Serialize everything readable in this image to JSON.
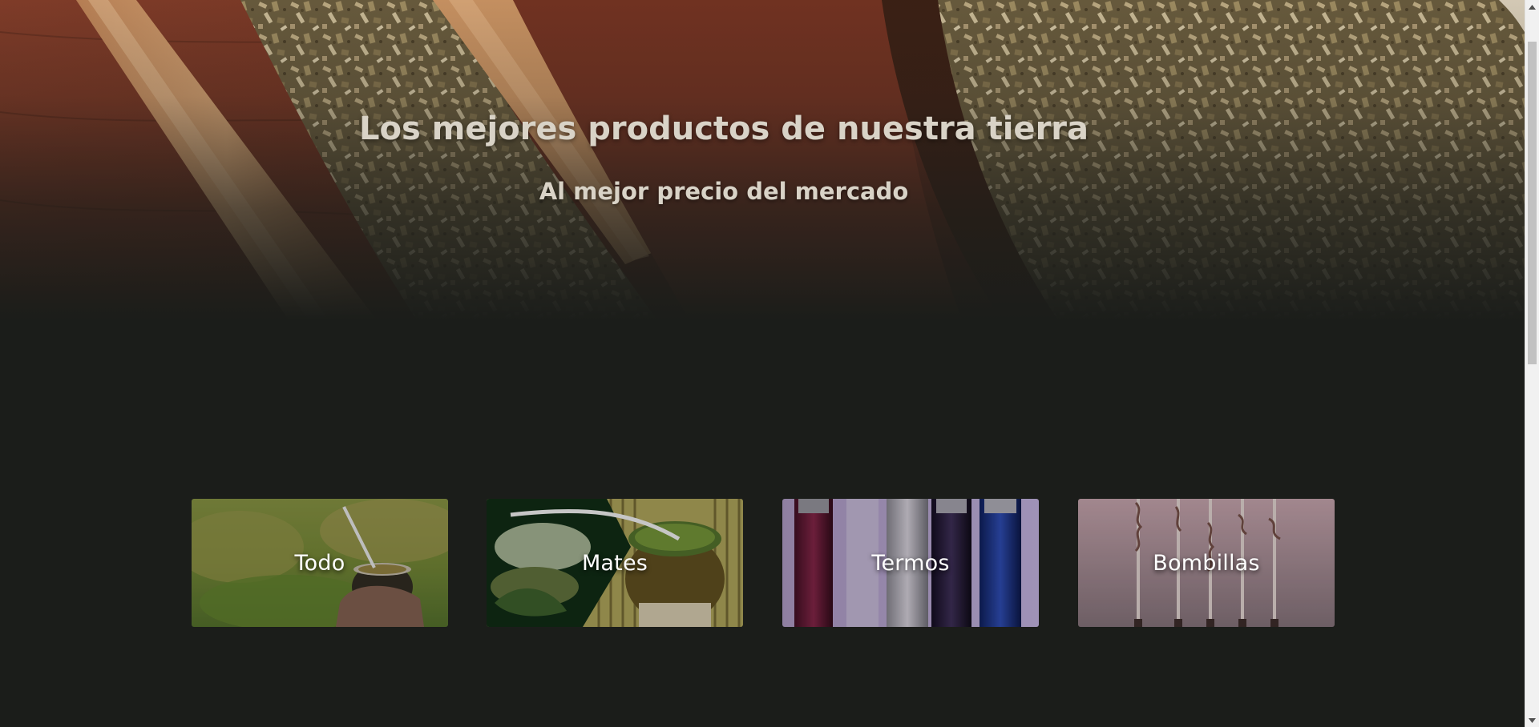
{
  "hero": {
    "title": "Los mejores productos de nuestra tierra",
    "subtitle": "Al mejor precio del mercado",
    "background_image": "yerba-mate-scoops-image"
  },
  "categories": [
    {
      "label": "Todo",
      "image": "mate-in-hand-field-image"
    },
    {
      "label": "Mates",
      "image": "mate-gourd-yerba-image"
    },
    {
      "label": "Termos",
      "image": "thermos-bottles-image"
    },
    {
      "label": "Bombillas",
      "image": "bombilla-straws-image"
    }
  ],
  "colors": {
    "page_background": "#1b1d1a",
    "hero_text": "#d9d3c7",
    "card_text": "#ffffff",
    "scrollbar_track": "#f1f1f1",
    "scrollbar_thumb": "#c1c1c1"
  }
}
